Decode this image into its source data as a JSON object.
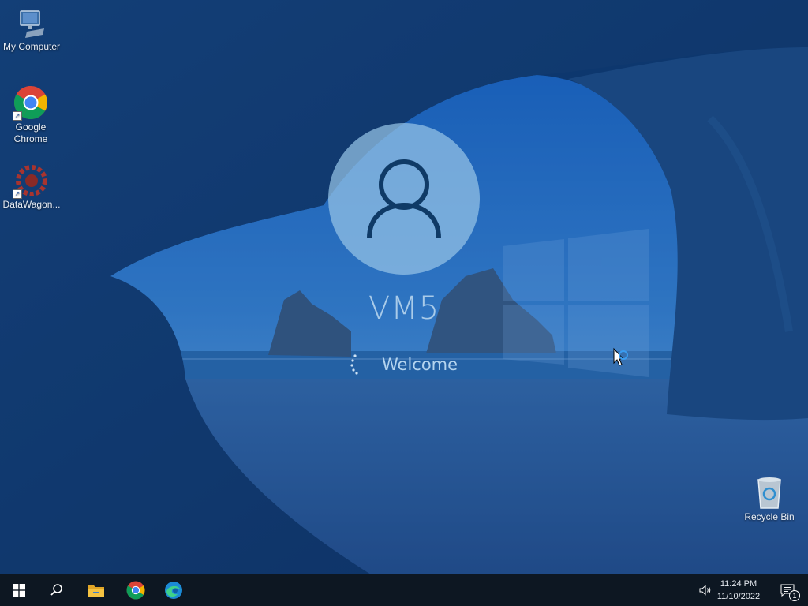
{
  "desktop": {
    "icons": [
      {
        "label": "My Computer",
        "icon": "monitor-icon"
      },
      {
        "label": "Google Chrome",
        "icon": "chrome-icon"
      },
      {
        "label": "DataWagon...",
        "icon": "datawagon-icon"
      },
      {
        "label": "Recycle Bin",
        "icon": "recycle-bin-icon"
      }
    ]
  },
  "login": {
    "username": "VM5",
    "status": "Welcome",
    "avatar_icon": "user-silhouette-icon"
  },
  "taskbar": {
    "start_icon": "windows-logo-icon",
    "search_icon": "search-icon",
    "pinned": [
      {
        "name": "File Explorer",
        "icon": "folder-icon"
      },
      {
        "name": "Google Chrome",
        "icon": "chrome-icon"
      },
      {
        "name": "Microsoft Edge",
        "icon": "edge-icon"
      }
    ],
    "tray": {
      "volume_icon": "speaker-icon",
      "time": "11:24 PM",
      "date": "11/10/2022",
      "notification_icon": "notification-icon",
      "notification_count": "1"
    }
  },
  "colors": {
    "taskbar": "#0d1722",
    "overlay": "#0c3a6c",
    "avatar": "#96c3e6",
    "text": "#b4d4ef"
  }
}
